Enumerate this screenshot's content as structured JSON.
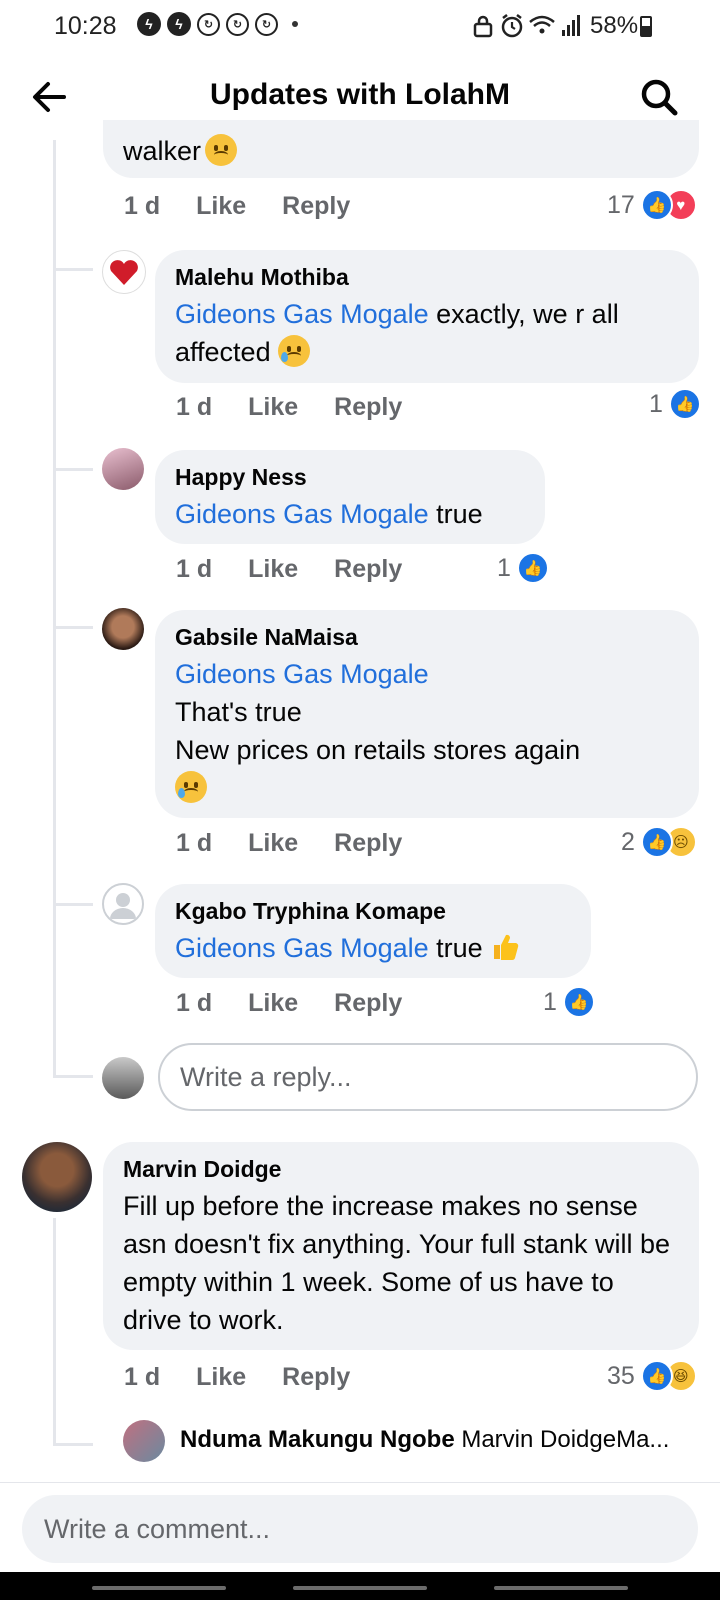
{
  "status_bar": {
    "time": "10:28",
    "battery": "58%"
  },
  "header": {
    "title": "Updates with LolahM"
  },
  "comments": [
    {
      "text": "walker",
      "time": "1 d",
      "like": "Like",
      "reply": "Reply",
      "reaction_count": "17"
    },
    {
      "author": "Malehu Mothiba",
      "mention": "Gideons Gas Mogale",
      "text": " exactly, we r all affected",
      "time": "1 d",
      "like": "Like",
      "reply": "Reply",
      "reaction_count": "1"
    },
    {
      "author": "Happy Ness",
      "mention": "Gideons Gas Mogale",
      "text": " true",
      "time": "1 d",
      "like": "Like",
      "reply": "Reply",
      "reaction_count": "1"
    },
    {
      "author": "Gabsile NaMaisa",
      "mention": "Gideons Gas Mogale",
      "line1": "That's true",
      "line2": "New prices on retails stores again",
      "time": "1 d",
      "like": "Like",
      "reply": "Reply",
      "reaction_count": "2"
    },
    {
      "author": "Kgabo Tryphina Komape",
      "mention": "Gideons Gas Mogale",
      "text": " true",
      "time": "1 d",
      "like": "Like",
      "reply": "Reply",
      "reaction_count": "1"
    },
    {
      "author": "Marvin Doidge",
      "text": "Fill up before the increase makes no sense asn doesn't fix anything. Your full stank will be empty within 1 week. Some of us have to drive to work.",
      "time": "1 d",
      "like": "Like",
      "reply": "Reply",
      "reaction_count": "35"
    }
  ],
  "reply_preview": {
    "author": "Nduma Makungu Ngobe",
    "text": "Marvin DoidgeMa..."
  },
  "reply_input": {
    "placeholder": "Write a reply..."
  },
  "comment_input": {
    "placeholder": "Write a comment..."
  },
  "colors": {
    "mention": "#216fdb",
    "like": "#1b74e4",
    "love": "#f33e58",
    "bubble": "#f0f2f5"
  }
}
